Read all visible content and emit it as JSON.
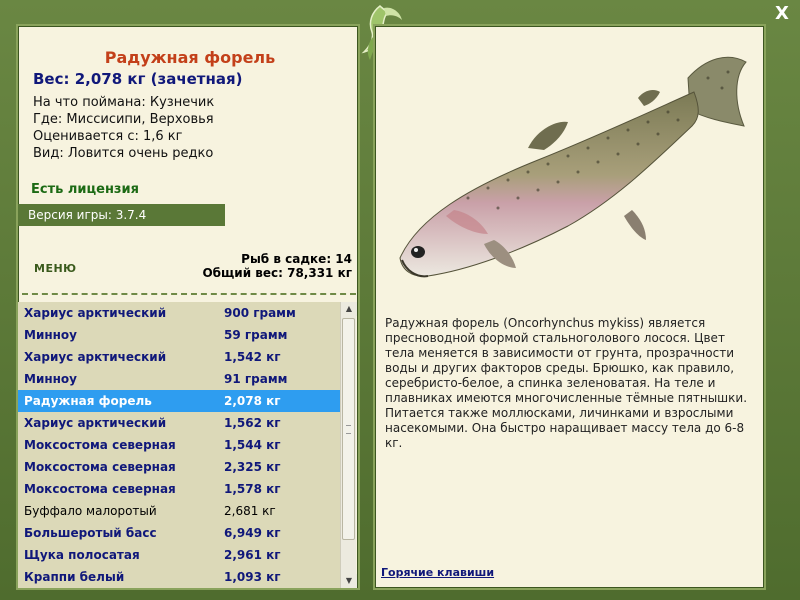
{
  "close_label": "X",
  "fish": {
    "title": "Радужная форель",
    "weight_line": "Вес: 2,078 кг (зачетная)",
    "caught_on": "На что поймана: Кузнечик",
    "location": "Где: Миссисипи, Верховья",
    "rated_from": "Оценивается с: 1,6 кг",
    "rarity": "Вид: Ловится очень редко"
  },
  "license": "Есть лицензия",
  "version": "Версия игры: 3.7.4",
  "menu_label": "МЕНЮ",
  "stats": {
    "count": "Рыб в садке: 14",
    "total": "Общий вес: 78,331 кг"
  },
  "catch_list": [
    {
      "name": "Хариус арктический",
      "weight": "900 грамм",
      "style": "bold"
    },
    {
      "name": "Минноу",
      "weight": "59 грамм",
      "style": "bold"
    },
    {
      "name": "Хариус арктический",
      "weight": "1,542 кг",
      "style": "bold"
    },
    {
      "name": "Минноу",
      "weight": "91 грамм",
      "style": "bold"
    },
    {
      "name": "Радужная форель",
      "weight": "2,078 кг",
      "style": "selected"
    },
    {
      "name": "Хариус арктический",
      "weight": "1,562 кг",
      "style": "bold"
    },
    {
      "name": "Моксостома северная",
      "weight": "1,544 кг",
      "style": "bold"
    },
    {
      "name": "Моксостома северная",
      "weight": "2,325 кг",
      "style": "bold"
    },
    {
      "name": "Моксостома северная",
      "weight": "1,578 кг",
      "style": "bold"
    },
    {
      "name": "Буффало малоротый",
      "weight": "2,681 кг",
      "style": "plain"
    },
    {
      "name": "Большеротый басс",
      "weight": "6,949 кг",
      "style": "bold"
    },
    {
      "name": "Щука полосатая",
      "weight": "2,961 кг",
      "style": "bold"
    },
    {
      "name": "Краппи белый",
      "weight": "1,093 кг",
      "style": "bold"
    }
  ],
  "description": "Радужная форель (Oncorhynchus mykiss) является пресноводной формой стальноголового лосося. Цвет тела меняется в зависимости от грунта, прозрачности воды и других факторов среды. Брюшко, как правило, серебристо-белое, а спинка зеленоватая. На теле и плавниках имеются многочисленные тёмные пятнышки. Питается также моллюсками, личинками и взрослыми насекомыми. Она быстро наращивает массу тела до 6-8 кг.",
  "hotkeys_label": "Горячие клавиши",
  "colors": {
    "frame": "#5d7a3a",
    "panel": "#f7f3df",
    "title": "#c3401a",
    "accent_blue": "#10187a",
    "license_green": "#1c6a14",
    "selection": "#2e9df0",
    "list_bg": "#dcd9b8"
  }
}
